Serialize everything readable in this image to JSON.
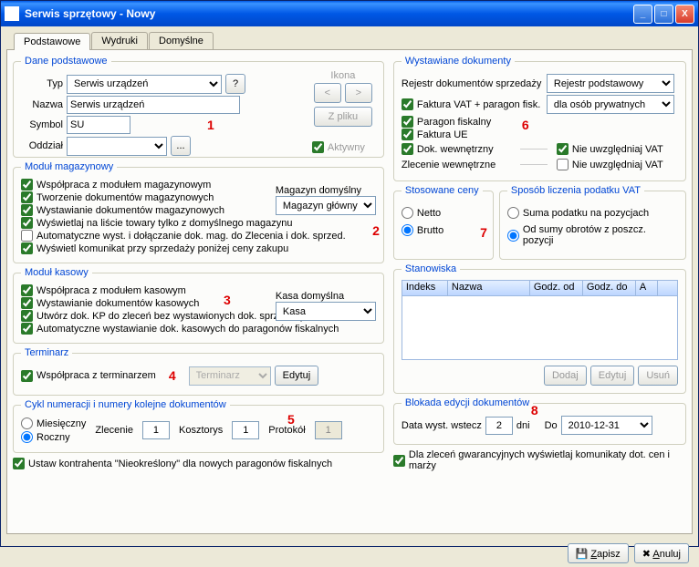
{
  "title": "Serwis sprzętowy - Nowy",
  "tabs": [
    "Podstawowe",
    "Wydruki",
    "Domyślne"
  ],
  "markers": [
    "1",
    "2",
    "3",
    "4",
    "5",
    "6",
    "7",
    "8"
  ],
  "basic": {
    "legend": "Dane podstawowe",
    "typ_lbl": "Typ",
    "typ_val": "Serwis urządzeń",
    "nazwa_lbl": "Nazwa",
    "nazwa_val": "Serwis urządzeń",
    "symbol_lbl": "Symbol",
    "symbol_val": "SU",
    "oddzial_lbl": "Oddział",
    "oddzial_val": "",
    "q": "?",
    "dots": "...",
    "ikona": "Ikona",
    "lt": "<",
    "gt": ">",
    "zpliku": "Z pliku",
    "aktywny": "Aktywny"
  },
  "mag": {
    "legend": "Moduł magazynowy",
    "c1": "Współpraca z modułem magazynowym",
    "c2": "Tworzenie dokumentów magazynowych",
    "c3": "Wystawianie dokumentów magazynowych",
    "c4": "Wyświetlaj na liście towary tylko z domyślnego magazynu",
    "c5": "Automatyczne wyst. i dołączanie dok. mag. do Zlecenia i dok. sprzed.",
    "c6": "Wyświetl komunikat przy sprzedaży poniżej ceny zakupu",
    "def_lbl": "Magazyn domyślny",
    "def_val": "Magazyn główny"
  },
  "kasa": {
    "legend": "Moduł kasowy",
    "c1": "Współpraca z modułem kasowym",
    "c2": "Wystawianie dokumentów kasowych",
    "c3": "Utwórz dok. KP do zleceń bez wystawionych dok. sprzedaży",
    "c4": "Automatyczne wystawianie dok. kasowych do paragonów fiskalnych",
    "def_lbl": "Kasa domyślna",
    "def_val": "Kasa"
  },
  "term": {
    "legend": "Terminarz",
    "c1": "Współpraca z terminarzem",
    "val": "Terminarz",
    "edit": "Edytuj"
  },
  "cykl": {
    "legend": "Cykl numeracji i numery kolejne dokumentów",
    "r1": "Miesięczny",
    "r2": "Roczny",
    "zlec": "Zlecenie",
    "zlec_v": "1",
    "koszt": "Kosztorys",
    "koszt_v": "1",
    "prot": "Protokół",
    "prot_v": "1"
  },
  "ustawk": "Ustaw kontrahenta \"Nieokreślony\" dla nowych paragonów fiskalnych",
  "docs": {
    "legend": "Wystawiane dokumenty",
    "rej_lbl": "Rejestr dokumentów sprzedaży",
    "rej_val": "Rejestr podstawowy",
    "c1": "Faktura VAT + paragon fisk.",
    "c1_val": "dla osób prywatnych",
    "c2": "Paragon fiskalny",
    "c3": "Faktura UE",
    "c4": "Dok. wewnętrzny",
    "c4b": "Nie uwzględniaj VAT",
    "c5": "Zlecenie wewnętrzne",
    "c5b": "Nie uwzględniaj VAT"
  },
  "ceny": {
    "legend": "Stosowane ceny",
    "r1": "Netto",
    "r2": "Brutto"
  },
  "vat": {
    "legend": "Sposób liczenia podatku VAT",
    "r1": "Suma podatku na pozycjach",
    "r2": "Od sumy obrotów z poszcz. pozycji"
  },
  "stan": {
    "legend": "Stanowiska",
    "h1": "Indeks",
    "h2": "Nazwa",
    "h3": "Godz. od",
    "h4": "Godz. do",
    "h5": "A",
    "b1": "Dodaj",
    "b2": "Edytuj",
    "b3": "Usuń"
  },
  "blok": {
    "legend": "Blokada edycji dokumentów",
    "l1": "Data wyst. wstecz",
    "v1": "2",
    "dni": "dni",
    "l2": "Do",
    "v2": "2010-12-31"
  },
  "gwar": "Dla zleceń gwarancyjnych wyświetlaj komunikaty dot. cen i marży",
  "zapisz": "Zapisz",
  "anuluj": "Anuluj"
}
